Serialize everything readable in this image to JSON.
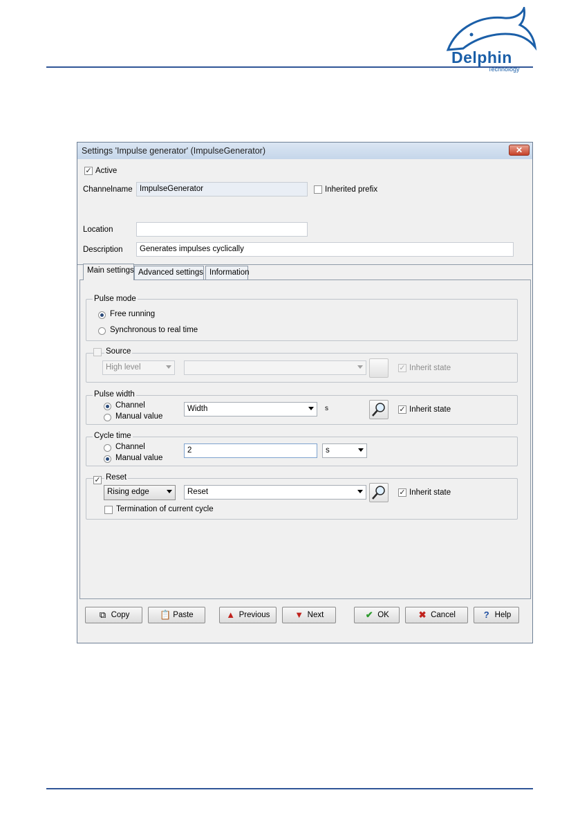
{
  "logo": {
    "text": "Delphin",
    "subtext": "Technology"
  },
  "dialog": {
    "title": "Settings 'Impulse generator' (ImpulseGenerator)",
    "close_glyph": "✕",
    "active_label": "Active",
    "active_checked": true,
    "channelname_label": "Channelname",
    "channelname_value": "ImpulseGenerator",
    "inherited_prefix_label": "Inherited prefix",
    "location_label": "Location",
    "location_value": "",
    "description_label": "Description",
    "description_value": "Generates impulses cyclically"
  },
  "tabs": [
    {
      "label": "Main settings",
      "active": true
    },
    {
      "label": "Advanced settings",
      "active": false
    },
    {
      "label": "Information",
      "active": false
    }
  ],
  "pulse_mode": {
    "title": "Pulse mode",
    "options": [
      "Free running",
      "Synchronous to real time"
    ],
    "selected": "Free running"
  },
  "source": {
    "title": "Source",
    "level_value": "High level",
    "channel_value": "",
    "inherit_label": "Inherit state"
  },
  "pulse_width": {
    "title": "Pulse width",
    "opt_channel": "Channel",
    "opt_manual": "Manual value",
    "selected": "Channel",
    "channel_value": "Width",
    "unit": "s",
    "inherit_label": "Inherit state"
  },
  "cycle_time": {
    "title": "Cycle time",
    "opt_channel": "Channel",
    "opt_manual": "Manual value",
    "selected": "Manual value",
    "value": "2",
    "unit": "s"
  },
  "reset": {
    "title": "Reset",
    "edge_value": "Rising edge",
    "channel_value": "Reset",
    "inherit_label": "Inherit state",
    "termination_label": "Termination of current cycle"
  },
  "buttons": {
    "copy": "Copy",
    "paste": "Paste",
    "previous": "Previous",
    "next": "Next",
    "ok": "OK",
    "cancel": "Cancel",
    "help": "Help"
  },
  "colors": {
    "accent": "#2f5597",
    "logo": "#1b5fa8",
    "ok_green": "#2e9b2e",
    "cancel_red": "#c0221d"
  }
}
